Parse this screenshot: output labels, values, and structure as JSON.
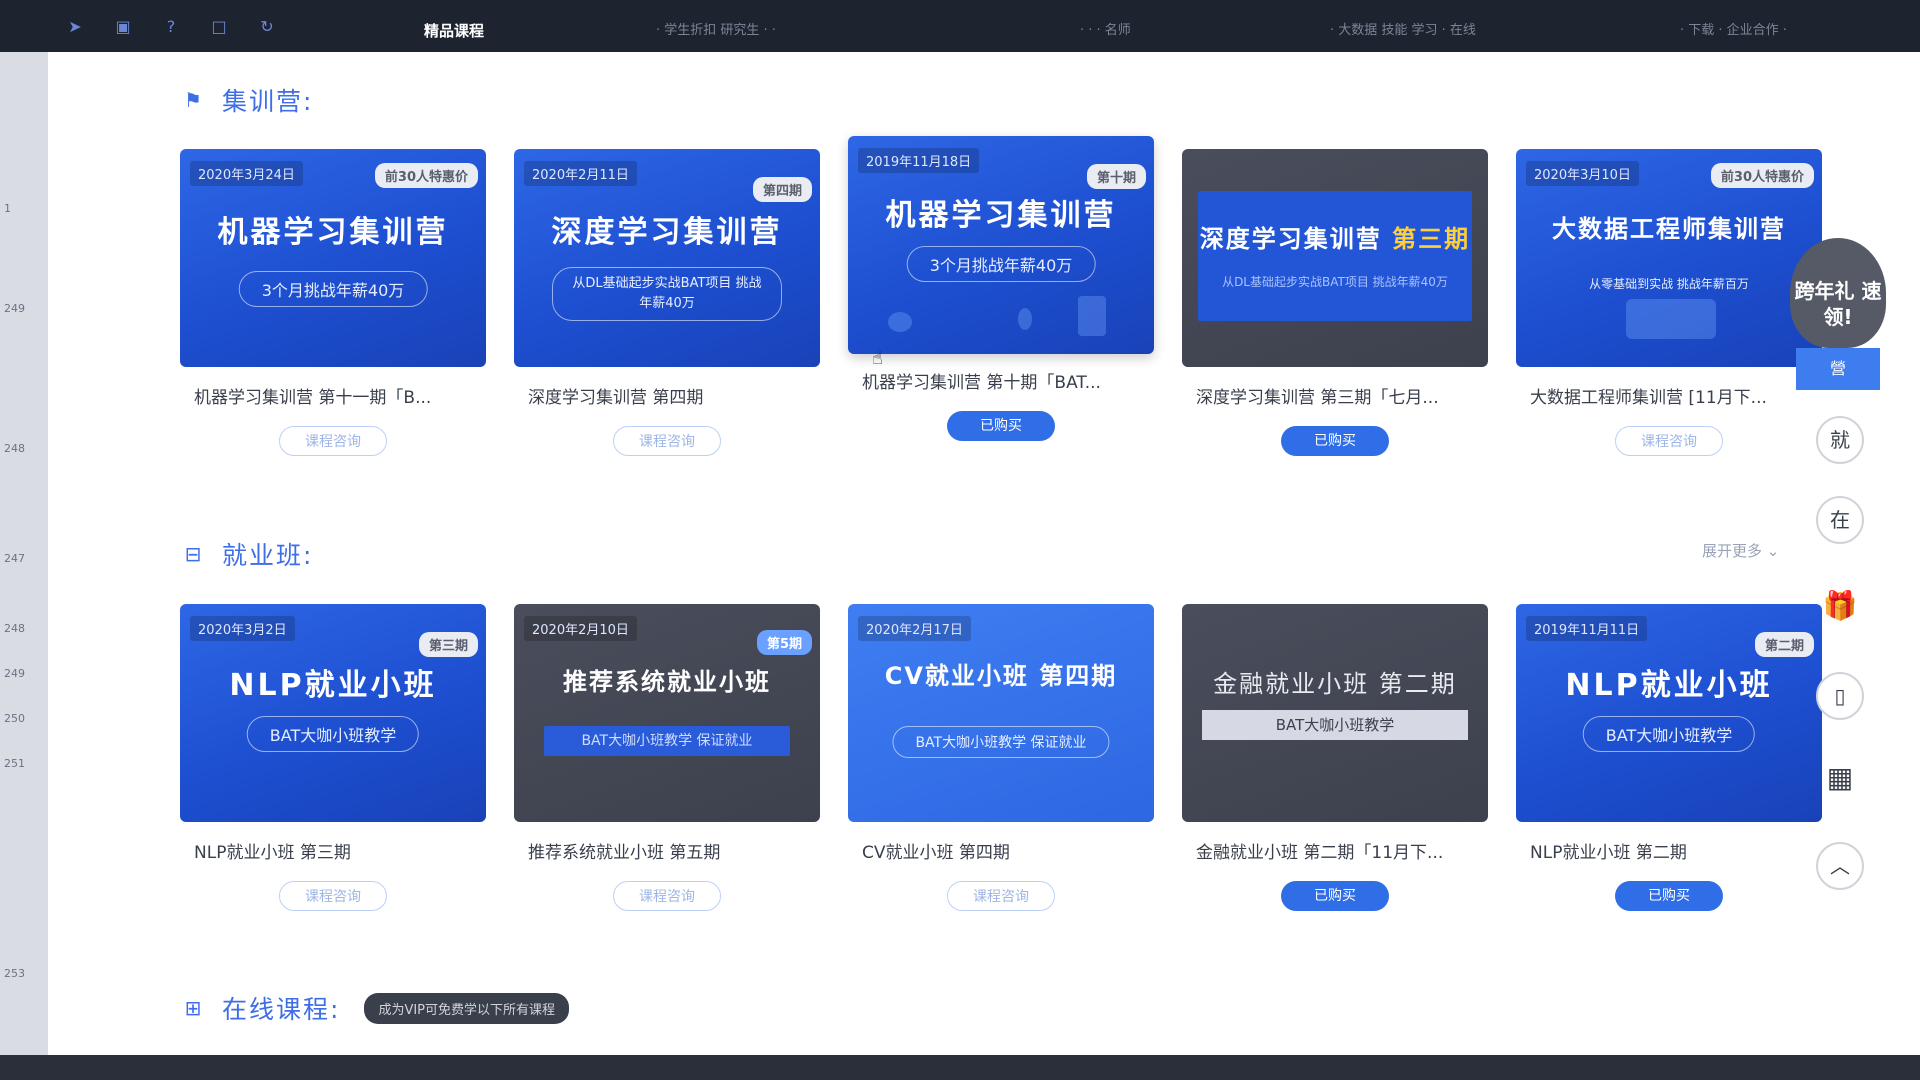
{
  "topbar": {
    "items": [
      {
        "label": "精品课程",
        "active": true
      },
      {
        "label": "· 学生折扣 研究生 · ·"
      },
      {
        "label": "· · · 名师"
      },
      {
        "label": "· 大数据 技能 学习 · 在线"
      },
      {
        "label": "· 下载 · 企业合作 ·"
      }
    ]
  },
  "leftrail": {
    "ticks": [
      "1",
      "249",
      "248",
      "247",
      "248",
      "249",
      "250",
      "251",
      "253"
    ]
  },
  "sections": {
    "camp": {
      "title": "集训营:",
      "cards": [
        {
          "date": "2020年3月24日",
          "badge": "前30人特惠价",
          "title": "机器学习集训营",
          "sub": "3个月挑战年薪40万",
          "label": "机器学习集训营 第十一期「B...",
          "button": "课程咨询",
          "style": "blue"
        },
        {
          "date": "2020年2月11日",
          "badge": "第四期",
          "title": "深度学习集训营",
          "sub": "从DL基础起步实战BAT项目 挑战年薪40万",
          "label": "深度学习集训营 第四期",
          "button": "课程咨询",
          "style": "blue"
        },
        {
          "date": "2019年11月18日",
          "badge": "第十期",
          "title": "机器学习集训营",
          "sub": "3个月挑战年薪40万",
          "label": "机器学习集训营 第十期「BAT...",
          "button": "已购买",
          "style": "blue"
        },
        {
          "date": "",
          "badge": "",
          "title": "深度学习集训营",
          "title_accent": "第三期",
          "sub": "从DL基础起步实战BAT项目 挑战年薪40万",
          "label": "深度学习集训营 第三期「七月...",
          "button": "已购买",
          "style": "dark"
        },
        {
          "date": "2020年3月10日",
          "badge": "前30人特惠价",
          "title": "大数据工程师集训营",
          "sub": "从零基础到实战 挑战年薪百万",
          "label": "大数据工程师集训营 [11月下...",
          "button": "课程咨询",
          "style": "blue"
        }
      ]
    },
    "job": {
      "title": "就业班:",
      "more": "展开更多",
      "cards": [
        {
          "date": "2020年3月2日",
          "badge": "第三期",
          "title": "NLP就业小班",
          "sub": "BAT大咖小班教学",
          "label": "NLP就业小班 第三期",
          "button": "课程咨询",
          "style": "blue"
        },
        {
          "date": "2020年2月10日",
          "badge": "第5期",
          "title": "推荐系统就业小班",
          "sub": "BAT大咖小班教学 保证就业",
          "label": "推荐系统就业小班 第五期",
          "button": "课程咨询",
          "style": "dark"
        },
        {
          "date": "2020年2月17日",
          "badge": "",
          "title": "CV就业小班 第四期",
          "sub": "BAT大咖小班教学 保证就业",
          "label": "CV就业小班 第四期",
          "button": "课程咨询",
          "style": "blue"
        },
        {
          "date": "",
          "badge": "",
          "title": "金融就业小班 第二期",
          "sub": "BAT大咖小班教学",
          "label": "金融就业小班 第二期「11月下...",
          "button": "已购买",
          "style": "dark"
        },
        {
          "date": "2019年11月11日",
          "badge": "第二期",
          "title": "NLP就业小班",
          "sub": "BAT大咖小班教学",
          "label": "NLP就业小班 第二期",
          "button": "已购买",
          "style": "blue"
        }
      ]
    },
    "online": {
      "title": "在线课程:",
      "pill": "成为VIP可免费学以下所有课程"
    }
  },
  "sidebar_tools": {
    "gift_text": "跨年礼 速领!",
    "gift_tag": "營",
    "btn_jiu": "就",
    "btn_zai": "在"
  }
}
